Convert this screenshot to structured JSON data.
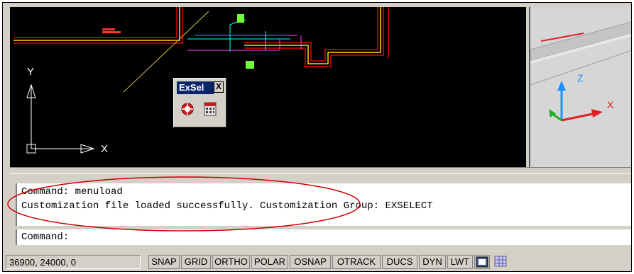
{
  "viewport": {
    "axis_y_label": "Y",
    "axis_x_label": "X",
    "view3d_axis_z": "Z",
    "view3d_axis_x": "X"
  },
  "palette": {
    "title": "ExSel",
    "close_label": "X",
    "buttons": [
      {
        "icon": "select-target-icon"
      },
      {
        "icon": "calculator-icon"
      }
    ]
  },
  "command": {
    "history": [
      "Command: menuload",
      "Customization file loaded successfully. Customization Group: EXSELECT"
    ],
    "prompt": "Command:"
  },
  "status_bar": {
    "coordinates": "36900, 24000, 0",
    "buttons": [
      "SNAP",
      "GRID",
      "ORTHO",
      "POLAR",
      "OSNAP",
      "OTRACK",
      "DUCS",
      "DYN",
      "LWT"
    ],
    "tray_icons": [
      "model-layout-icon",
      "grid-tray-icon"
    ]
  },
  "colors": {
    "annotation_ellipse": "#d00000",
    "palette_title_bg": "#0a246a"
  }
}
